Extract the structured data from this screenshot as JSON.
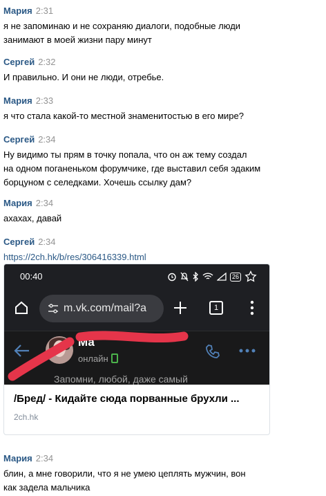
{
  "messages": [
    {
      "author": "Мария",
      "time": "2:31",
      "text": "я не запоминаю и не сохраняю диалоги, подобные люди\nзанимают в моей жизни пару минут"
    },
    {
      "author": "Сергей",
      "time": "2:32",
      "text": "И правильно. И они не люди, отребье."
    },
    {
      "author": "Мария",
      "time": "2:33",
      "text": "я что стала какой-то местной знаменитостью в его мире?"
    },
    {
      "author": "Сергей",
      "time": "2:34",
      "text": "Ну видимо ты прям в точку попала, что он аж тему создал\nна одном поганеньком форумчике, где выставил себя эдаким\nборцуном с селедками. Хочешь ссылку дам?"
    },
    {
      "author": "Мария",
      "time": "2:34",
      "text": "ахахах, давай"
    },
    {
      "author": "Сергей",
      "time": "2:34",
      "link": "https://2ch.hk/b/res/306416339.html"
    },
    {
      "author": "Мария",
      "time": "2:34",
      "text": "блин, а мне говорили, что я не умею цеплять мужчин, вон\nкак задела мальчика"
    }
  ],
  "link_preview": {
    "title": "/Бред/ - Кидайте сюда порванные брухли ...",
    "site": "2ch.hk",
    "screenshot": {
      "clock": "00:40",
      "battery": "26",
      "url": "m.vk.com/mail?a",
      "tab_count": "1",
      "contact_name": "Ма",
      "status": "онлайн",
      "message_preview": "Запомни, любой, даже самый",
      "colors": {
        "redact": "#e5354a",
        "background": "#1e1f23",
        "accent": "#5181b8"
      }
    }
  }
}
